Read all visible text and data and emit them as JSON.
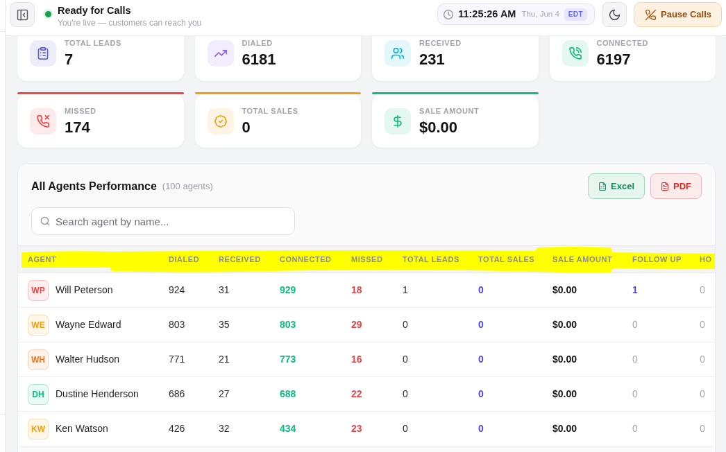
{
  "header": {
    "status": {
      "live": true,
      "title": "Ready for Calls",
      "subtitle": "You're live — customers can reach you"
    },
    "clock": {
      "time": "11:25:26 AM",
      "date": "Thu, Jun 4",
      "zone": "EDT"
    },
    "pause_button": {
      "label": "Pause Calls"
    }
  },
  "stats": [
    {
      "kind": "leads",
      "label": "TOTAL LEADS",
      "value": "7",
      "color": "#5b5fd6",
      "top_bar": false
    },
    {
      "kind": "dialed",
      "label": "DIALED",
      "value": "6181",
      "color": "#8b5cf6",
      "top_bar": false
    },
    {
      "kind": "received",
      "label": "RECEIVED",
      "value": "231",
      "color": "#06b6d4",
      "top_bar": false
    },
    {
      "kind": "connected",
      "label": "CONNECTED",
      "value": "6197",
      "color": "#10b981",
      "top_bar": false
    },
    {
      "kind": "missed",
      "label": "MISSED",
      "value": "174",
      "color": "#ef4444",
      "top_bar": true
    },
    {
      "kind": "sales",
      "label": "TOTAL SALES",
      "value": "0",
      "color": "#f59e0b",
      "top_bar": true
    },
    {
      "kind": "amount",
      "label": "SALE AMOUNT",
      "value": "$0.00",
      "color": "#10b981",
      "top_bar": true
    }
  ],
  "performance": {
    "title": "All Agents Performance",
    "count": "(100 agents)",
    "export_buttons": [
      {
        "kind": "excel",
        "label": "Excel"
      },
      {
        "kind": "pdf",
        "label": "PDF"
      }
    ],
    "search": {
      "placeholder": "Search agent by name..."
    },
    "header_highlighted": true,
    "columns": [
      {
        "label": "AGENT",
        "kind": "agent"
      },
      {
        "label": "DIALED",
        "kind": "plain"
      },
      {
        "label": "RECEIVED",
        "kind": "plain"
      },
      {
        "label": "CONNECTED",
        "kind": "good"
      },
      {
        "label": "MISSED",
        "kind": "bad"
      },
      {
        "label": "TOTAL LEADS",
        "kind": "plain"
      },
      {
        "label": "TOTAL SALES",
        "kind": "sales"
      },
      {
        "label": "SALE AMOUNT",
        "kind": "money"
      },
      {
        "label": "FOLLOW UP",
        "kind": "followup"
      },
      {
        "label": "HO",
        "kind": "muted"
      }
    ],
    "rows": [
      {
        "initials": "WP",
        "color": "#ef4444",
        "follow_up_pending": true,
        "cells": [
          "Will Peterson",
          "924",
          "31",
          "929",
          "18",
          "1",
          "0",
          "$0.00",
          "1",
          "0"
        ]
      },
      {
        "initials": "WE",
        "color": "#f59e0b",
        "follow_up_pending": false,
        "cells": [
          "Wayne Edward",
          "803",
          "35",
          "803",
          "29",
          "0",
          "0",
          "$0.00",
          "0",
          "0"
        ]
      },
      {
        "initials": "WH",
        "color": "#f97316",
        "follow_up_pending": false,
        "cells": [
          "Walter Hudson",
          "771",
          "21",
          "773",
          "16",
          "0",
          "0",
          "$0.00",
          "0",
          "0"
        ]
      },
      {
        "initials": "DH",
        "color": "#10b981",
        "follow_up_pending": false,
        "cells": [
          "Dustine Henderson",
          "686",
          "27",
          "688",
          "22",
          "0",
          "0",
          "$0.00",
          "0",
          "0"
        ]
      },
      {
        "initials": "KW",
        "color": "#f59e0b",
        "follow_up_pending": false,
        "cells": [
          "Ken Watson",
          "426",
          "32",
          "434",
          "23",
          "0",
          "0",
          "$0.00",
          "0",
          "0"
        ]
      }
    ]
  }
}
